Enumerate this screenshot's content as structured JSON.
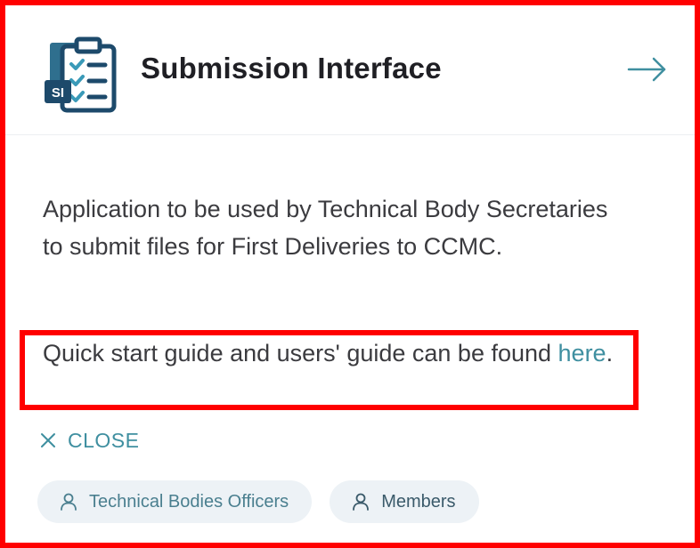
{
  "card": {
    "title": "Submission Interface",
    "icon_badge": "SI",
    "description": "Application to be used by Technical Body Secretaries to submit files for First Deliveries to CCMC.",
    "guide_text": "Quick start guide and users' guide can be found ",
    "guide_link": "here",
    "guide_suffix": ".",
    "close_label": "CLOSE",
    "tags": [
      {
        "label": "Technical Bodies Officers",
        "icon": "user-icon"
      },
      {
        "label": "Members",
        "icon": "user-icon"
      }
    ]
  },
  "colors": {
    "annotation_red": "#ff0000",
    "accent_teal": "#3f8fa0",
    "icon_navy": "#1d4a6b",
    "tag_bg": "#edf2f6"
  }
}
